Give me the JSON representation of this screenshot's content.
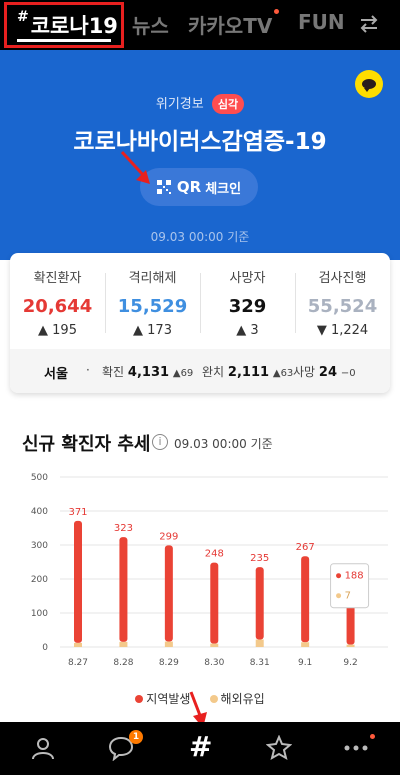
{
  "tabs": {
    "active": {
      "hash": "#",
      "label": "코로나19"
    },
    "news": "뉴스",
    "kakaotv": "카카오TV",
    "fun": "FUN"
  },
  "hero": {
    "crisis_label": "위기경보",
    "crisis_level": "심각",
    "title": "코로나바이러스감염증-19",
    "qr_text": "QR",
    "checkin_text": "체크인",
    "date": "09.03 00:00 기준"
  },
  "stats": [
    {
      "label": "확진환자",
      "value": "20,644",
      "delta": "▲ 195",
      "color": "#e53935"
    },
    {
      "label": "격리해제",
      "value": "15,529",
      "delta": "▲ 173",
      "color": "#3f8fe0"
    },
    {
      "label": "사망자",
      "value": "329",
      "delta": "▲ 3",
      "color": "#111111"
    },
    {
      "label": "검사진행",
      "value": "55,524",
      "delta": "▼ 1,224",
      "color": "#aab2c0"
    }
  ],
  "region": {
    "name": "서울",
    "bullet": "·",
    "confirmed_label": "확진",
    "confirmed_value": "4,131",
    "confirmed_delta": "▲69",
    "released_label": "완치",
    "released_value": "2,111",
    "released_delta": "▲63",
    "deaths_label": "사망",
    "deaths_value": "24",
    "deaths_delta": "−0"
  },
  "chart_section": {
    "title": "신규 확진자 추세",
    "info_icon": "i",
    "date": "09.03 00:00 기준"
  },
  "chart_data": {
    "type": "bar",
    "categories": [
      "8.27",
      "8.28",
      "8.29",
      "8.30",
      "8.31",
      "9.1",
      "9.2"
    ],
    "series": [
      {
        "name": "지역발생",
        "values": [
          359,
          308,
          283,
          238,
          213,
          253,
          188
        ],
        "color": "#ea4335"
      },
      {
        "name": "해외유입",
        "values": [
          12,
          15,
          16,
          10,
          22,
          14,
          7
        ],
        "color": "#f3c98b"
      }
    ],
    "totals": [
      "371",
      "323",
      "299",
      "248",
      "235",
      "267",
      "195"
    ],
    "ylim": [
      0,
      500
    ],
    "yticks": [
      "0",
      "100",
      "200",
      "300",
      "400",
      "500"
    ],
    "tooltip": {
      "local": "188",
      "overseas": "7"
    }
  },
  "legend": {
    "local": "지역발생",
    "overseas": "해외유입"
  },
  "nav": {
    "chat_badge": "1"
  }
}
